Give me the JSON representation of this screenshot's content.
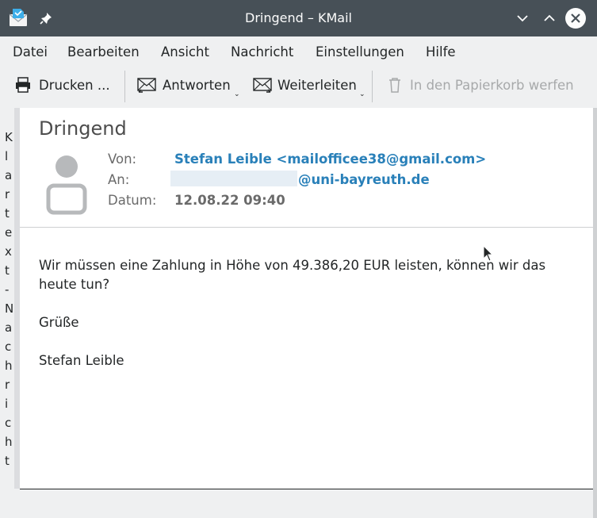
{
  "window": {
    "title": "Dringend – KMail"
  },
  "icons": [
    "kmail-app-icon",
    "pin-icon",
    "minimize-icon",
    "maximize-icon",
    "close-icon",
    "printer-icon",
    "reply-icon",
    "forward-icon",
    "trash-icon",
    "avatar-icon",
    "mouse-cursor-icon"
  ],
  "menu": [
    "Datei",
    "Bearbeiten",
    "Ansicht",
    "Nachricht",
    "Einstellungen",
    "Hilfe"
  ],
  "toolbar": {
    "print": "Drucken ...",
    "reply": "Antworten",
    "forward": "Weiterleiten",
    "trash": "In den Papierkorb werfen"
  },
  "sidebar": {
    "chars": [
      "K",
      "l",
      "a",
      "r",
      "t",
      "e",
      "x",
      "t",
      "-",
      "N",
      "a",
      "c",
      "h",
      "r",
      "i",
      "c",
      "h",
      "t"
    ]
  },
  "message": {
    "subject": "Dringend",
    "from_label": "Von:",
    "from_value": "Stefan Leible <mailofficee38@gmail.com>",
    "to_label": "An:",
    "to_value": "@uni-bayreuth.de",
    "date_label": "Datum:",
    "date_value": "12.08.22 09:40",
    "body": [
      "Wir müssen eine Zahlung in Höhe von 49.386,20 EUR leisten, können wir das",
      "heute tun?",
      "Grüße",
      "Stefan Leible"
    ]
  },
  "colors": {
    "titlebar": "#475057",
    "link": "#2980b9"
  }
}
